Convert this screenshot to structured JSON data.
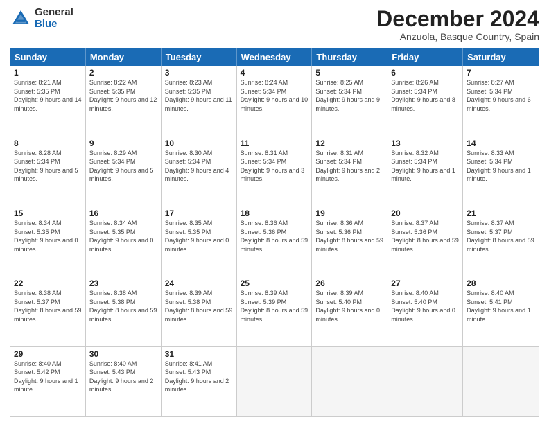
{
  "header": {
    "logo_general": "General",
    "logo_blue": "Blue",
    "month_title": "December 2024",
    "location": "Anzuola, Basque Country, Spain"
  },
  "calendar": {
    "days_of_week": [
      "Sunday",
      "Monday",
      "Tuesday",
      "Wednesday",
      "Thursday",
      "Friday",
      "Saturday"
    ],
    "weeks": [
      [
        {
          "day": "",
          "empty": true
        },
        {
          "day": "",
          "empty": true
        },
        {
          "day": "",
          "empty": true
        },
        {
          "day": "",
          "empty": true
        },
        {
          "day": "",
          "empty": true
        },
        {
          "day": "",
          "empty": true
        },
        {
          "day": "",
          "empty": true
        }
      ],
      [
        {
          "day": "1",
          "sunrise": "8:21 AM",
          "sunset": "5:35 PM",
          "daylight": "9 hours and 14 minutes."
        },
        {
          "day": "2",
          "sunrise": "8:22 AM",
          "sunset": "5:35 PM",
          "daylight": "9 hours and 12 minutes."
        },
        {
          "day": "3",
          "sunrise": "8:23 AM",
          "sunset": "5:35 PM",
          "daylight": "9 hours and 11 minutes."
        },
        {
          "day": "4",
          "sunrise": "8:24 AM",
          "sunset": "5:34 PM",
          "daylight": "9 hours and 10 minutes."
        },
        {
          "day": "5",
          "sunrise": "8:25 AM",
          "sunset": "5:34 PM",
          "daylight": "9 hours and 9 minutes."
        },
        {
          "day": "6",
          "sunrise": "8:26 AM",
          "sunset": "5:34 PM",
          "daylight": "9 hours and 8 minutes."
        },
        {
          "day": "7",
          "sunrise": "8:27 AM",
          "sunset": "5:34 PM",
          "daylight": "9 hours and 6 minutes."
        }
      ],
      [
        {
          "day": "8",
          "sunrise": "8:28 AM",
          "sunset": "5:34 PM",
          "daylight": "9 hours and 5 minutes."
        },
        {
          "day": "9",
          "sunrise": "8:29 AM",
          "sunset": "5:34 PM",
          "daylight": "9 hours and 5 minutes."
        },
        {
          "day": "10",
          "sunrise": "8:30 AM",
          "sunset": "5:34 PM",
          "daylight": "9 hours and 4 minutes."
        },
        {
          "day": "11",
          "sunrise": "8:31 AM",
          "sunset": "5:34 PM",
          "daylight": "9 hours and 3 minutes."
        },
        {
          "day": "12",
          "sunrise": "8:31 AM",
          "sunset": "5:34 PM",
          "daylight": "9 hours and 2 minutes."
        },
        {
          "day": "13",
          "sunrise": "8:32 AM",
          "sunset": "5:34 PM",
          "daylight": "9 hours and 1 minute."
        },
        {
          "day": "14",
          "sunrise": "8:33 AM",
          "sunset": "5:34 PM",
          "daylight": "9 hours and 1 minute."
        }
      ],
      [
        {
          "day": "15",
          "sunrise": "8:34 AM",
          "sunset": "5:35 PM",
          "daylight": "9 hours and 0 minutes."
        },
        {
          "day": "16",
          "sunrise": "8:34 AM",
          "sunset": "5:35 PM",
          "daylight": "9 hours and 0 minutes."
        },
        {
          "day": "17",
          "sunrise": "8:35 AM",
          "sunset": "5:35 PM",
          "daylight": "9 hours and 0 minutes."
        },
        {
          "day": "18",
          "sunrise": "8:36 AM",
          "sunset": "5:36 PM",
          "daylight": "8 hours and 59 minutes."
        },
        {
          "day": "19",
          "sunrise": "8:36 AM",
          "sunset": "5:36 PM",
          "daylight": "8 hours and 59 minutes."
        },
        {
          "day": "20",
          "sunrise": "8:37 AM",
          "sunset": "5:36 PM",
          "daylight": "8 hours and 59 minutes."
        },
        {
          "day": "21",
          "sunrise": "8:37 AM",
          "sunset": "5:37 PM",
          "daylight": "8 hours and 59 minutes."
        }
      ],
      [
        {
          "day": "22",
          "sunrise": "8:38 AM",
          "sunset": "5:37 PM",
          "daylight": "8 hours and 59 minutes."
        },
        {
          "day": "23",
          "sunrise": "8:38 AM",
          "sunset": "5:38 PM",
          "daylight": "8 hours and 59 minutes."
        },
        {
          "day": "24",
          "sunrise": "8:39 AM",
          "sunset": "5:38 PM",
          "daylight": "8 hours and 59 minutes."
        },
        {
          "day": "25",
          "sunrise": "8:39 AM",
          "sunset": "5:39 PM",
          "daylight": "8 hours and 59 minutes."
        },
        {
          "day": "26",
          "sunrise": "8:39 AM",
          "sunset": "5:40 PM",
          "daylight": "9 hours and 0 minutes."
        },
        {
          "day": "27",
          "sunrise": "8:40 AM",
          "sunset": "5:40 PM",
          "daylight": "9 hours and 0 minutes."
        },
        {
          "day": "28",
          "sunrise": "8:40 AM",
          "sunset": "5:41 PM",
          "daylight": "9 hours and 1 minute."
        }
      ],
      [
        {
          "day": "29",
          "sunrise": "8:40 AM",
          "sunset": "5:42 PM",
          "daylight": "9 hours and 1 minute."
        },
        {
          "day": "30",
          "sunrise": "8:40 AM",
          "sunset": "5:43 PM",
          "daylight": "9 hours and 2 minutes."
        },
        {
          "day": "31",
          "sunrise": "8:41 AM",
          "sunset": "5:43 PM",
          "daylight": "9 hours and 2 minutes."
        },
        {
          "day": "",
          "empty": true
        },
        {
          "day": "",
          "empty": true
        },
        {
          "day": "",
          "empty": true
        },
        {
          "day": "",
          "empty": true
        }
      ]
    ]
  }
}
